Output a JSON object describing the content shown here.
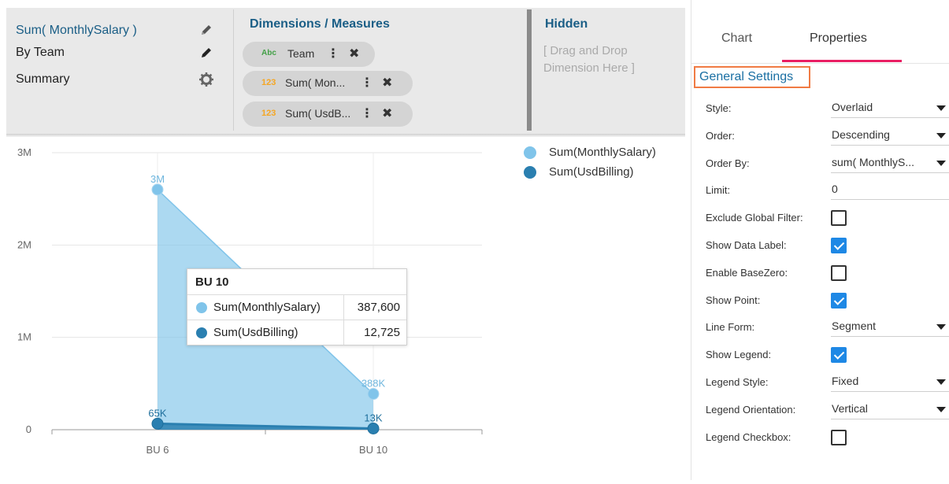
{
  "designer": {
    "rows": [
      {
        "label": "Sum( MonthlySalary )",
        "icon": "pencil-icon",
        "color": "#1a5e86"
      },
      {
        "label": "By Team",
        "icon": "pencil-icon",
        "color": "#222222"
      },
      {
        "label": "Summary",
        "icon": "gear-icon",
        "color": "#222222"
      }
    ],
    "dimensions_title": "Dimensions / Measures",
    "pills": [
      {
        "type": "Abc",
        "type_color": "#43a047",
        "label": "Team"
      },
      {
        "type": "123",
        "type_color": "#f5a623",
        "label": "Sum( Mon..."
      },
      {
        "type": "123",
        "type_color": "#f5a623",
        "label": "Sum( UsdB..."
      }
    ],
    "hidden_title": "Hidden",
    "hidden_hint": "[ Drag and Drop Dimension Here ]"
  },
  "chart_data": {
    "type": "area",
    "categories": [
      "BU 6",
      "BU 10"
    ],
    "series": [
      {
        "name": "Sum(MonthlySalary)",
        "values": [
          2600000,
          387600
        ],
        "labels": [
          "3M",
          "388K"
        ],
        "color": "#80c4ea"
      },
      {
        "name": "Sum(UsdBilling)",
        "values": [
          65000,
          12725
        ],
        "labels": [
          "65K",
          "13K"
        ],
        "color": "#2a7fb0"
      }
    ],
    "y_ticks": [
      "0",
      "1M",
      "2M",
      "3M"
    ],
    "ylim": [
      0,
      3000000
    ],
    "grid": true,
    "legend_position": "top-right"
  },
  "tooltip": {
    "title": "BU 10",
    "rows": [
      {
        "name": "Sum(MonthlySalary)",
        "value": "387,600",
        "color": "#80c4ea"
      },
      {
        "name": "Sum(UsdBilling)",
        "value": "12,725",
        "color": "#2a7fb0"
      }
    ]
  },
  "properties": {
    "tabs": [
      "Chart",
      "Properties"
    ],
    "active_tab": "Properties",
    "section_title": "General Settings",
    "items": [
      {
        "label": "Style:",
        "kind": "select",
        "value": "Overlaid"
      },
      {
        "label": "Order:",
        "kind": "select",
        "value": "Descending"
      },
      {
        "label": "Order By:",
        "kind": "select",
        "value": "sum( MonthlyS..."
      },
      {
        "label": "Limit:",
        "kind": "input",
        "value": "0"
      },
      {
        "label": "Exclude Global Filter:",
        "kind": "checkbox",
        "checked": false
      },
      {
        "label": "Show Data Label:",
        "kind": "checkbox",
        "checked": true
      },
      {
        "label": "Enable BaseZero:",
        "kind": "checkbox",
        "checked": false
      },
      {
        "label": "Show Point:",
        "kind": "checkbox",
        "checked": true
      },
      {
        "label": "Line Form:",
        "kind": "select",
        "value": "Segment"
      },
      {
        "label": "Show Legend:",
        "kind": "checkbox",
        "checked": true
      },
      {
        "label": "Legend Style:",
        "kind": "select",
        "value": "Fixed"
      },
      {
        "label": "Legend Orientation:",
        "kind": "select",
        "value": "Vertical"
      },
      {
        "label": "Legend Checkbox:",
        "kind": "checkbox",
        "checked": false
      }
    ]
  },
  "colors": {
    "accent": "#e91e63",
    "highlight_border": "#f07b44",
    "check": "#1e88e5"
  }
}
